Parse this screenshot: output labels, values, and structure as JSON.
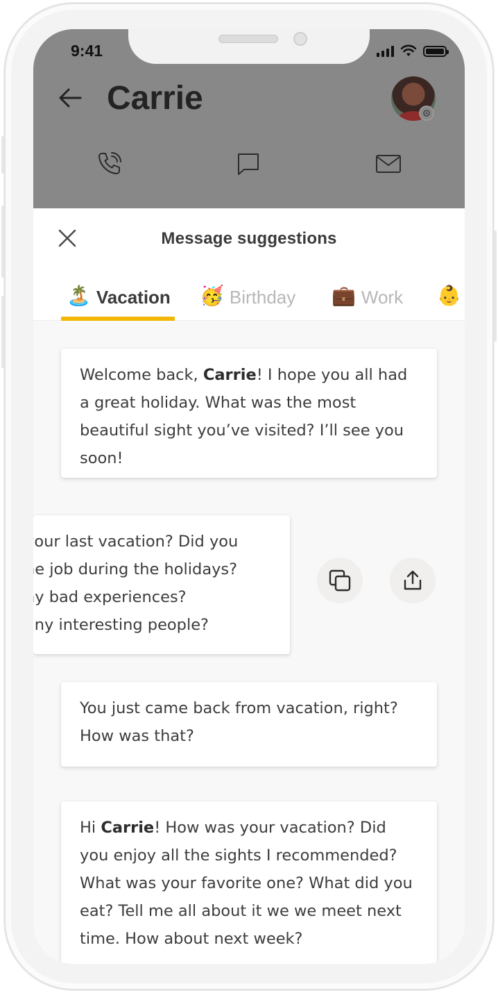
{
  "status_bar": {
    "time": "9:41"
  },
  "header": {
    "contact_name": "Carrie"
  },
  "sheet": {
    "title": "Message suggestions",
    "tabs": [
      {
        "emoji": "🏝️",
        "label": "Vacation",
        "active": true
      },
      {
        "emoji": "🥳",
        "label": "Birthday",
        "active": false
      },
      {
        "emoji": "💼",
        "label": "Work",
        "active": false
      },
      {
        "emoji": "👶",
        "label": "",
        "active": false
      }
    ]
  },
  "messages": [
    {
      "pre": "Welcome back, ",
      "name": "Carrie",
      "post": "! I hope you all had a great holiday. What was the most beautiful sight you’ve visited? I’ll see you soon!"
    },
    {
      "lines": [
        "your last vacation? Did you",
        "he job during the holidays?",
        "ny bad experiences?",
        "any interesting people?"
      ]
    },
    {
      "text": "You just came back from vacation, right? How was that?"
    },
    {
      "pre": "Hi ",
      "name": "Carrie",
      "post": "! How was your vacation? Did you enjoy all the sights I recommended? What was your favorite one? What did you eat? Tell me all about it we we meet next time. How about next week?"
    }
  ],
  "colors": {
    "accent": "#f2b705",
    "header_dim": "#888888"
  },
  "icons": [
    "back-arrow-icon",
    "phone-icon",
    "chat-icon",
    "mail-icon",
    "close-icon",
    "copy-icon",
    "share-icon",
    "settings-icon"
  ]
}
